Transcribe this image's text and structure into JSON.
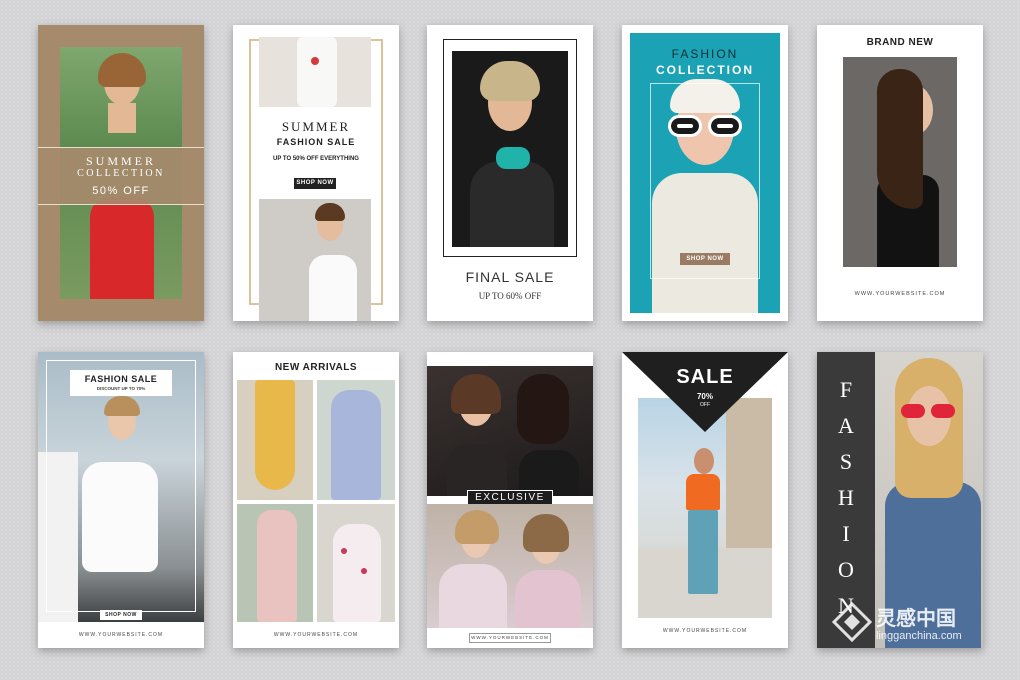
{
  "cards": {
    "c1": {
      "title": "SUMMER",
      "subtitle": "COLLECTION",
      "offer": "50% OFF"
    },
    "c2": {
      "title": "SUMMER",
      "subtitle": "FASHION SALE",
      "offer": "UP TO 50% OFF EVERYTHING",
      "button": "SHOP NOW"
    },
    "c3": {
      "title": "FINAL SALE",
      "offer": "UP TO 60% OFF"
    },
    "c4": {
      "title1": "FASHION",
      "title2": "COLLECTION",
      "button": "SHOP NOW"
    },
    "c5": {
      "title": "BRAND NEW",
      "url": "WWW.YOURWEBSITE.COM"
    },
    "c6": {
      "title": "FASHION SALE",
      "offer": "DISCOUNT UP TO 70%",
      "button": "SHOP NOW",
      "url": "WWW.YOURWEBSITE.COM"
    },
    "c7": {
      "title": "NEW ARRIVALS",
      "url": "WWW.YOURWEBSITE.COM"
    },
    "c8": {
      "title": "EXCLUSIVE",
      "url": "WWW.YOURWEBSITE.COM"
    },
    "c9": {
      "title": "SALE",
      "percent": "70%",
      "off": "OFF",
      "url": "WWW.YOURWEBSITE.COM"
    },
    "c10": {
      "letters": [
        "F",
        "A",
        "S",
        "H",
        "I",
        "O",
        "N"
      ]
    }
  },
  "watermark": {
    "brand": "灵感中国",
    "site": "lingganchina.com"
  },
  "colors": {
    "tan": "#a68a6c",
    "teal": "#1ba3b5",
    "charcoal": "#2f2f2f",
    "black": "#1f1f1f"
  }
}
